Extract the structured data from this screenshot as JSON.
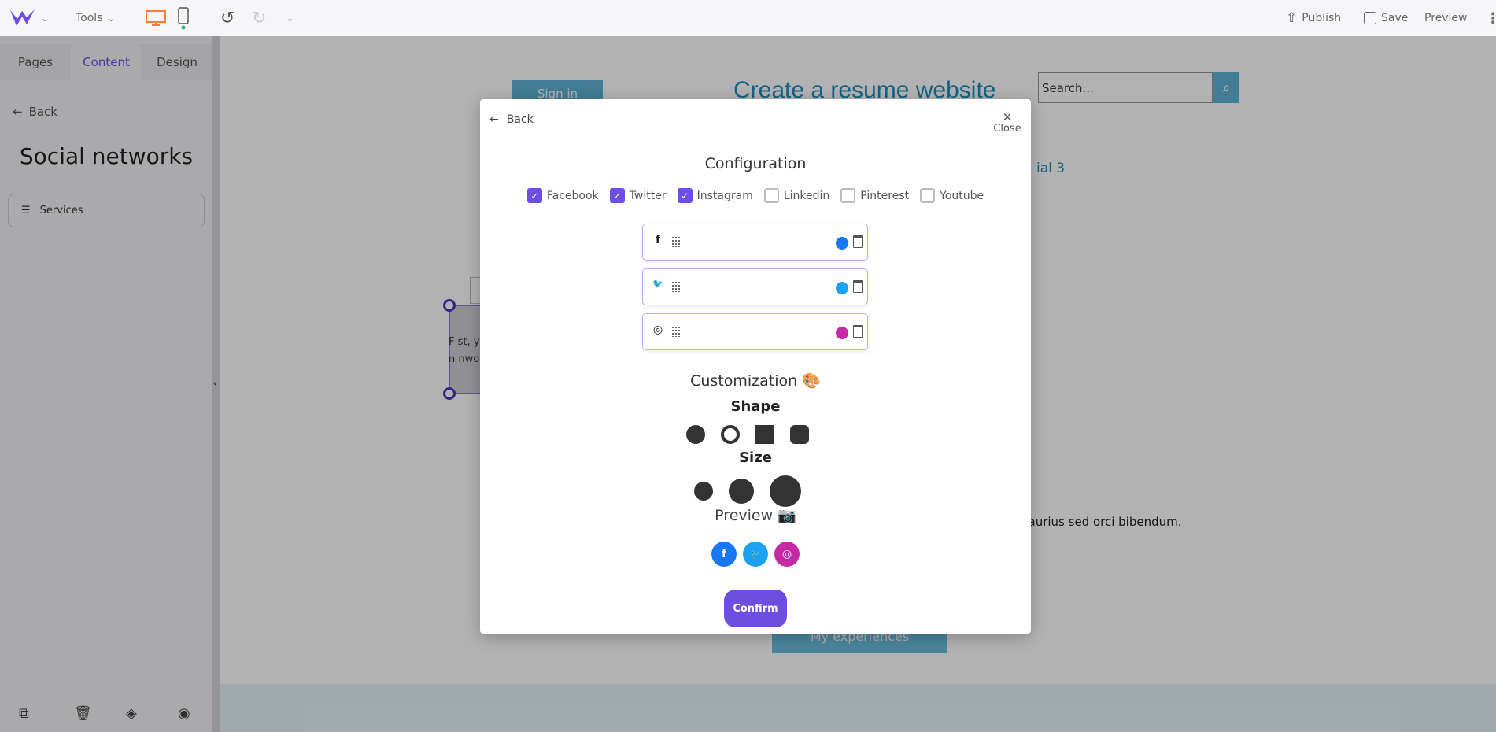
{
  "topbar": {
    "tools_label": "Tools",
    "publish_label": "Publish",
    "save_label": "Save",
    "preview_label": "Preview",
    "accent": "#6c4ee3",
    "device_active_color": "#f47c3c"
  },
  "sidebar": {
    "tabs": [
      {
        "label": "Pages"
      },
      {
        "label": "Content",
        "active": true
      },
      {
        "label": "Design"
      }
    ],
    "back_label": "Back",
    "title": "Social networks",
    "services_label": "Services"
  },
  "page": {
    "sign_in": "Sign in",
    "title": "Create a resume website",
    "search_placeholder": "Search...",
    "social_fragment": "ial 3",
    "body_fragment": "naurius sed orci bibendum.",
    "experiences_button": "My experiences",
    "fragment1": "F  st, y",
    "fragment2": "n  nwo"
  },
  "modal": {
    "back_label": "Back",
    "close_label": "Close",
    "config_title": "Configuration",
    "networks": [
      {
        "label": "Facebook",
        "checked": true
      },
      {
        "label": "Twitter",
        "checked": true
      },
      {
        "label": "Instagram",
        "checked": true
      },
      {
        "label": "Linkedin",
        "checked": false
      },
      {
        "label": "Pinterest",
        "checked": false
      },
      {
        "label": "Youtube",
        "checked": false
      }
    ],
    "rows": [
      {
        "icon": "facebook-icon",
        "glyph": "f",
        "color": "#1877f2"
      },
      {
        "icon": "twitter-icon",
        "glyph": "🐦",
        "color": "#1da1f2"
      },
      {
        "icon": "instagram-icon",
        "glyph": "◎",
        "color": "#c32aa3"
      }
    ],
    "customization_title": "Customization 🎨",
    "shape_title": "Shape",
    "size_title": "Size",
    "preview_title": "Preview 📷",
    "confirm_label": "Confirm"
  }
}
